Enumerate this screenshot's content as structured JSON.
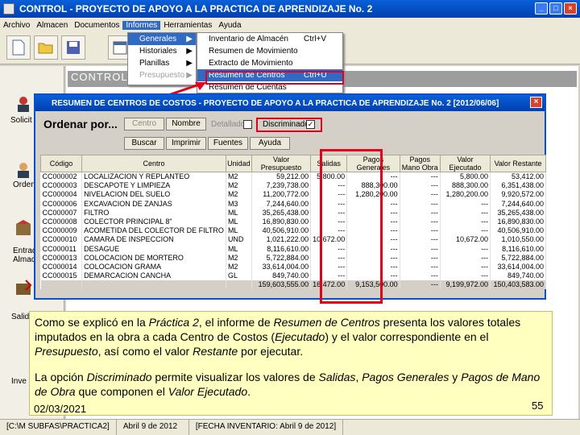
{
  "window": {
    "title": "CONTROL - PROYECTO DE APOYO A LA PRACTICA DE APRENDIZAJE No. 2",
    "min": "_",
    "max": "□",
    "close": "×"
  },
  "menu": [
    "Archivo",
    "Almacen",
    "Documentos",
    "Informes",
    "Herramientas",
    "Ayuda"
  ],
  "informes_menu": [
    "Generales",
    "Historiales",
    "Planillas",
    "Presupuesto"
  ],
  "generales_submenu": [
    {
      "label": "Inventario de Almacén",
      "shortcut": "Ctrl+V"
    },
    {
      "label": "Resumen de Movimiento",
      "shortcut": ""
    },
    {
      "label": "Extracto de Movimiento",
      "shortcut": ""
    },
    {
      "label": "Resumen de Centros",
      "shortcut": "Ctrl+U"
    },
    {
      "label": "Resumen de Cuentas",
      "shortcut": ""
    }
  ],
  "control_strip": "CONTROL -",
  "left_panel": [
    "Solicit",
    "Orden de Co",
    "Entrad al Almac",
    "Salid Alm",
    "Inve"
  ],
  "dialog": {
    "title": "RESUMEN DE CENTROS DE COSTOS - PROYECTO DE APOYO A LA PRACTICA DE APRENDIZAJE No. 2 [2012/06/06]",
    "close": "×",
    "ordenar": "Ordenar por...",
    "buttons": {
      "centro": "Centro",
      "nombre": "Nombre",
      "buscar": "Buscar",
      "imprimir": "Imprimir",
      "fuentes": "Fuentes",
      "ayuda": "Ayuda"
    },
    "detallado": "Detallado",
    "discriminado": "Discriminado",
    "discriminado_check": "✓",
    "columns": [
      "Código",
      "Centro",
      "Unidad",
      "Valor Presupuesto",
      "Salidas",
      "Pagos Generales",
      "Pagos Mano Obra",
      "Valor Ejecutado",
      "Valor Restante"
    ],
    "rows": [
      [
        "CC000002",
        "LOCALIZACION Y REPLANTEO",
        "M2",
        "59,212.00",
        "5,800.00",
        "---",
        "---",
        "5,800.00",
        "53,412.00"
      ],
      [
        "CC000003",
        "DESCAPOTE Y LIMPIEZA",
        "M2",
        "7,239,738.00",
        "---",
        "888,300.00",
        "---",
        "888,300.00",
        "6,351,438.00"
      ],
      [
        "CC000004",
        "NIVELACION DEL SUELO",
        "M2",
        "11,200,772.00",
        "---",
        "1,280,200.00",
        "---",
        "1,280,200.00",
        "9,920,572.00"
      ],
      [
        "CC000006",
        "EXCAVACION DE ZANJAS",
        "M3",
        "7,244,640.00",
        "---",
        "---",
        "---",
        "---",
        "7,244,640.00"
      ],
      [
        "CC000007",
        "FILTRO",
        "ML",
        "35,265,438.00",
        "---",
        "---",
        "---",
        "---",
        "35,265,438.00"
      ],
      [
        "CC000008",
        "COLECTOR PRINCIPAL 8\"",
        "ML",
        "16,890,830.00",
        "---",
        "---",
        "---",
        "---",
        "16,890,830.00"
      ],
      [
        "CC000009",
        "ACOMETIDA DEL COLECTOR DE FILTRO",
        "ML",
        "40,506,910.00",
        "---",
        "---",
        "---",
        "---",
        "40,506,910.00"
      ],
      [
        "CC000010",
        "CAMARA DE INSPECCION",
        "UND",
        "1,021,222.00",
        "10,672.00",
        "---",
        "---",
        "10,672.00",
        "1,010,550.00"
      ],
      [
        "CC000011",
        "DESAGUE",
        "ML",
        "8,116,610.00",
        "---",
        "---",
        "---",
        "---",
        "8,116,610.00"
      ],
      [
        "CC000013",
        "COLOCACION DE MORTERO",
        "M2",
        "5,722,884.00",
        "---",
        "---",
        "---",
        "---",
        "5,722,884.00"
      ],
      [
        "CC000014",
        "COLOCACION GRAMA",
        "M2",
        "33,614,004.00",
        "---",
        "---",
        "---",
        "---",
        "33,614,004.00"
      ],
      [
        "CC000015",
        "DEMARCACION CANCHA",
        "GL",
        "849,740.00",
        "---",
        "---",
        "---",
        "---",
        "849,740.00"
      ]
    ],
    "totals": [
      "",
      "",
      "",
      "159,603,555.00",
      "16,472.00",
      "9,153,500.00",
      "---",
      "9,199,972.00",
      "150,403,583.00"
    ]
  },
  "callout": {
    "p1_a": "Como se explicó en la ",
    "p1_b": "Práctica 2",
    "p1_c": ", el informe de ",
    "p1_d": "Resumen de Centros",
    "p1_e": " presenta los valores totales imputados en la obra a cada Centro de Costos (",
    "p1_f": "Ejecutado",
    "p1_g": ") y el valor correspondiente en el ",
    "p1_h": "Presupuesto",
    "p1_i": ", así como el valor ",
    "p1_j": "Restante",
    "p1_k": " por ejecutar.",
    "p2_a": "La opción ",
    "p2_b": "Discriminado",
    "p2_c": " permite visualizar los valores de ",
    "p2_d": "Salidas",
    "p2_e": ", ",
    "p2_f": "Pagos Generales",
    "p2_g": " y ",
    "p2_h": "Pagos de Mano de Obra",
    "p2_i": " que componen el ",
    "p2_j": "Valor Ejecutado",
    "p2_k": "."
  },
  "footer": {
    "date": "02/03/2021",
    "page": "55"
  },
  "status": [
    "[C:\\M SUBFAS\\PRACTICA2]",
    "Abril 9 de 2012",
    "[FECHA INVENTARIO: Abril 9 de 2012]"
  ]
}
